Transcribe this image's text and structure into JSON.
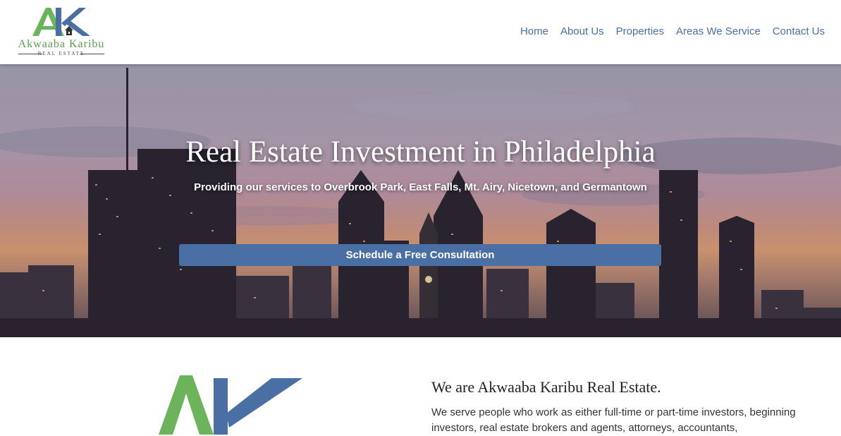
{
  "brand": {
    "monogram": "AK",
    "name": "Akwaaba Karibu",
    "tagline": "REAL ESTATE",
    "colors": {
      "green": "#6cb45c",
      "blue": "#4a6fa5"
    }
  },
  "nav": {
    "items": [
      {
        "label": "Home"
      },
      {
        "label": "About Us"
      },
      {
        "label": "Properties"
      },
      {
        "label": "Areas We Service"
      },
      {
        "label": "Contact Us"
      }
    ],
    "color": "#4a6fa5"
  },
  "hero": {
    "title": "Real Estate Investment in Philadelphia",
    "subtitle": "Providing our services to Overbrook Park, East Falls, Mt. Airy, Nicetown, and Germantown",
    "cta_label": "Schedule a Free Consultation",
    "cta_color": "#4a6fa5"
  },
  "about": {
    "title": "We are Akwaaba Karibu Real Estate.",
    "text": "We serve people who work as either full-time or part-time investors, beginning investors, real estate brokers and agents, attorneys, accountants,"
  }
}
